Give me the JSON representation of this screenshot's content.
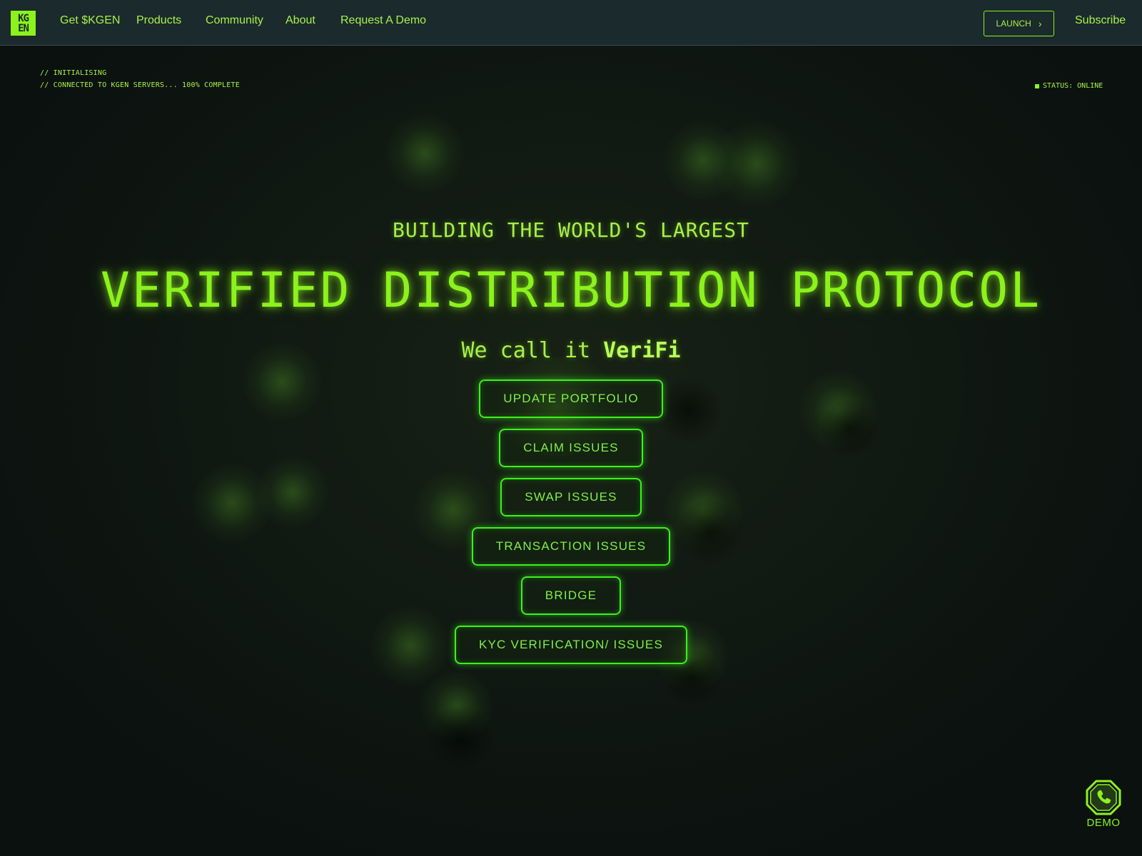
{
  "nav": {
    "logo_lines": [
      "KG",
      "EN"
    ],
    "links": [
      {
        "label": "Get $KGEN"
      },
      {
        "label": "Products"
      },
      {
        "label": "Community"
      },
      {
        "label": "About"
      },
      {
        "label": "Request A Demo"
      }
    ],
    "launch_label": "LAUNCH",
    "subscribe_label": "Subscribe"
  },
  "terminal": {
    "line1": "// INITIALISING",
    "line2": "// CONNECTED TO KGEN SERVERS... 100% COMPLETE",
    "status": "STATUS: ONLINE"
  },
  "hero": {
    "eyebrow": "BUILDING THE WORLD'S LARGEST",
    "headline": "VERIFIED DISTRIBUTION PROTOCOL",
    "subline_prefix": "We call it ",
    "subline_emphasis": "VeriFi"
  },
  "actions": [
    {
      "label": "UPDATE PORTFOLIO"
    },
    {
      "label": "CLAIM ISSUES"
    },
    {
      "label": "SWAP ISSUES"
    },
    {
      "label": "TRANSACTION ISSUES"
    },
    {
      "label": "BRIDGE"
    },
    {
      "label": "KYC VERIFICATION/ ISSUES"
    }
  ],
  "demo": {
    "label": "DEMO",
    "icon": "phone-icon"
  },
  "colors": {
    "accent": "#8cf21c",
    "nav_bg": "#1b2a2c",
    "page_bg": "#0c1310",
    "button_border": "#3cf01c"
  }
}
